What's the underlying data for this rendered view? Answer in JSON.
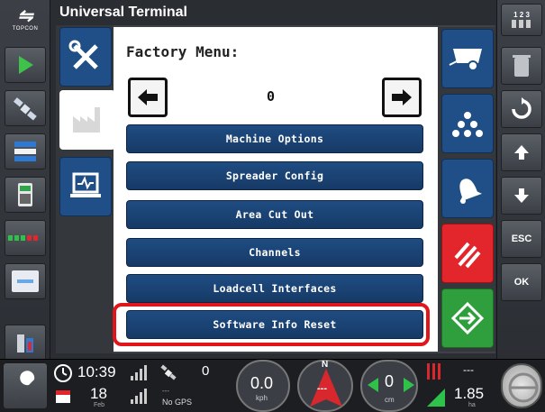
{
  "window": {
    "title": "Universal Terminal"
  },
  "logo": {
    "text": "TOPCON"
  },
  "menu": {
    "title": "Factory Menu:",
    "page": "0",
    "items": [
      {
        "label": "Machine Options"
      },
      {
        "label": "Spreader Config"
      },
      {
        "label": "Area Cut Out"
      },
      {
        "label": "Channels"
      },
      {
        "label": "Loadcell Interfaces"
      },
      {
        "label": "Software Info Reset"
      }
    ],
    "highlighted_item": "Software Info Reset"
  },
  "right_strip": {
    "top_label": "1 2 3",
    "esc_label": "ESC",
    "ok_label": "OK"
  },
  "status": {
    "time": "10:39",
    "date_day": "18",
    "date_month": "Feb",
    "satellite_count": "0",
    "gps_status": "No GPS",
    "gps_dashes": "---",
    "speed_value": "0.0",
    "speed_unit": "kph",
    "heading_label": "N",
    "heading_value": "---",
    "offset_value": "0",
    "offset_unit": "cm",
    "area_top": "---",
    "area_value": "1.85",
    "area_unit": "ha"
  },
  "colors": {
    "button_blue": "#1f4f86",
    "alert_red": "#e3262b",
    "enter_green": "#2f9e3c",
    "highlight_red": "#e0161b"
  }
}
